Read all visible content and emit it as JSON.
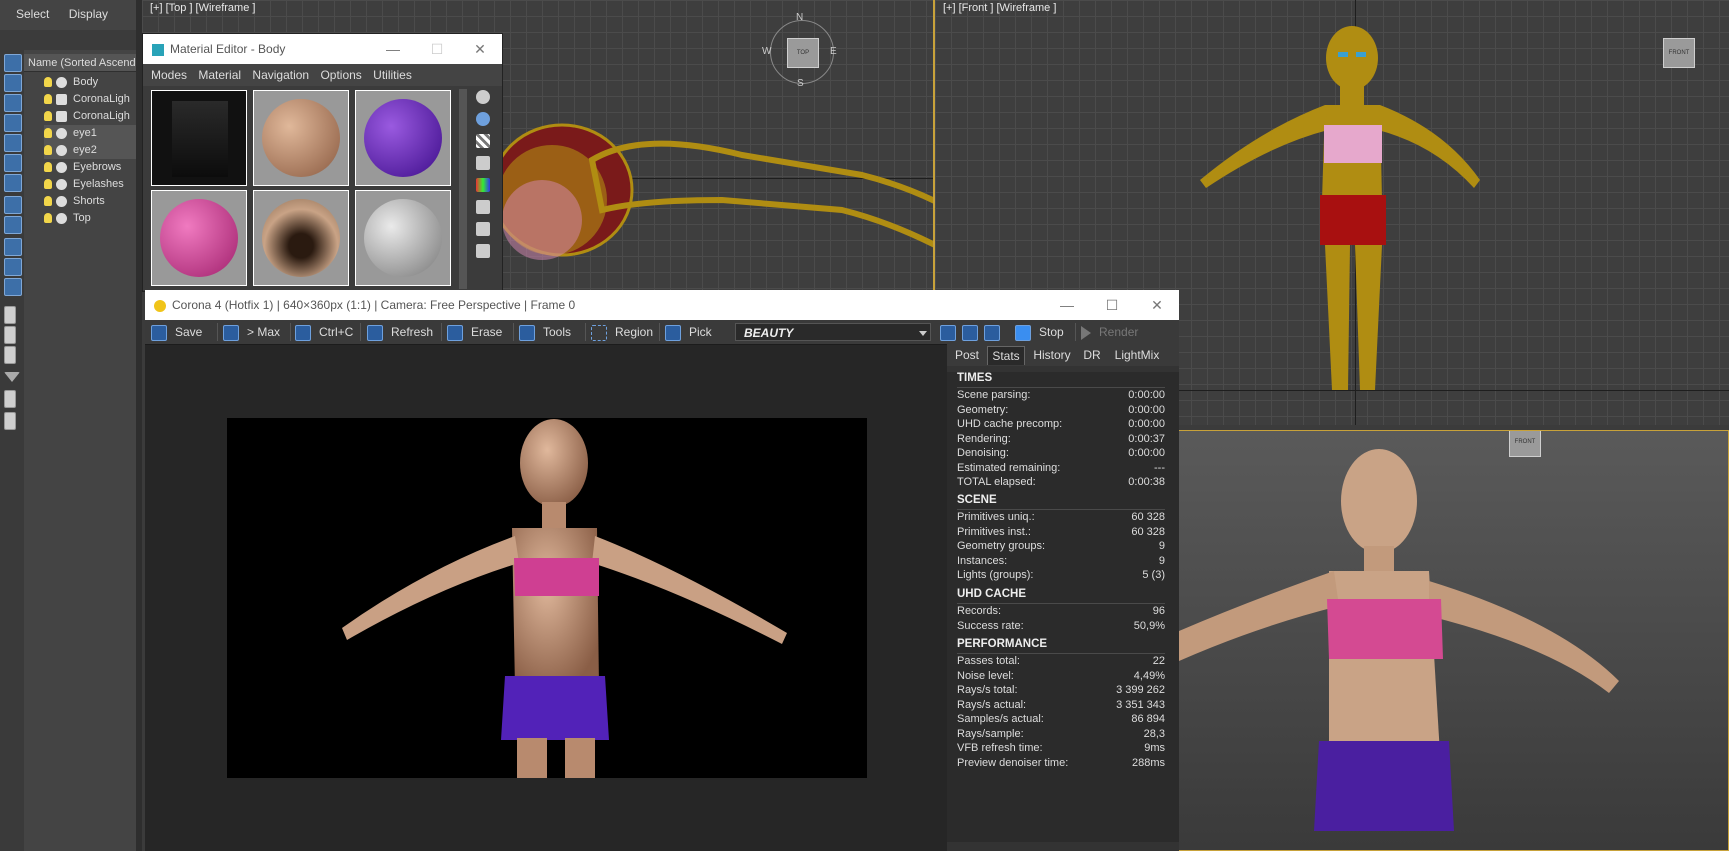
{
  "top_menu": {
    "select": "Select",
    "display": "Display"
  },
  "scene_explorer": {
    "header": "Name (Sorted Ascendi",
    "items": [
      {
        "label": "Body",
        "type": "object"
      },
      {
        "label": "CoronaLigh",
        "type": "light"
      },
      {
        "label": "CoronaLigh",
        "type": "light"
      },
      {
        "label": "eye1",
        "type": "object"
      },
      {
        "label": "eye2",
        "type": "object"
      },
      {
        "label": "Eyebrows",
        "type": "object"
      },
      {
        "label": "Eyelashes",
        "type": "object"
      },
      {
        "label": "Shorts",
        "type": "object"
      },
      {
        "label": "Top",
        "type": "object"
      }
    ]
  },
  "viewports": {
    "top": {
      "label": "[+] [Top ] [Wireframe ]",
      "compass": {
        "n": "N",
        "s": "S",
        "e": "E",
        "w": "W",
        "center": "TOP"
      }
    },
    "front": {
      "label": "[+] [Front ] [Wireframe ]",
      "cube": "FRONT"
    },
    "perspective": {
      "cube": "FRONT"
    }
  },
  "material_editor": {
    "title": "Material Editor - Body",
    "menu": [
      "Modes",
      "Material",
      "Navigation",
      "Options",
      "Utilities"
    ],
    "controls": {
      "minimize": "—",
      "maximize": "☐",
      "close": "✕"
    }
  },
  "vfb": {
    "title": "Corona 4 (Hotfix 1) | 640×360px (1:1) | Camera: Free Perspective | Frame 0",
    "controls": {
      "minimize": "—",
      "maximize": "☐",
      "close": "✕"
    },
    "toolbar": {
      "save": "Save",
      "max": "> Max",
      "copy": "Ctrl+C",
      "refresh": "Refresh",
      "erase": "Erase",
      "tools": "Tools",
      "region": "Region",
      "pick": "Pick",
      "channel": "BEAUTY",
      "stop": "Stop",
      "render": "Render"
    },
    "tabs": [
      "Post",
      "Stats",
      "History",
      "DR",
      "LightMix"
    ],
    "active_tab": "Stats",
    "stats": {
      "times_title": "TIMES",
      "times": [
        {
          "k": "Scene parsing:",
          "v": "0:00:00"
        },
        {
          "k": "Geometry:",
          "v": "0:00:00"
        },
        {
          "k": "UHD cache precomp:",
          "v": "0:00:00"
        },
        {
          "k": "Rendering:",
          "v": "0:00:37"
        },
        {
          "k": "Denoising:",
          "v": "0:00:00"
        },
        {
          "k": "Estimated remaining:",
          "v": "---"
        },
        {
          "k": "TOTAL elapsed:",
          "v": "0:00:38"
        }
      ],
      "scene_title": "SCENE",
      "scene": [
        {
          "k": "Primitives uniq.:",
          "v": "60 328"
        },
        {
          "k": "Primitives inst.:",
          "v": "60 328"
        },
        {
          "k": "Geometry groups:",
          "v": "9"
        },
        {
          "k": "Instances:",
          "v": "9"
        },
        {
          "k": "Lights (groups):",
          "v": "5 (3)"
        }
      ],
      "uhd_title": "UHD CACHE",
      "uhd": [
        {
          "k": "Records:",
          "v": "96"
        },
        {
          "k": "Success rate:",
          "v": "50,9%"
        }
      ],
      "perf_title": "PERFORMANCE",
      "perf": [
        {
          "k": "Passes total:",
          "v": "22"
        },
        {
          "k": "Noise level:",
          "v": "4,49%"
        },
        {
          "k": "Rays/s total:",
          "v": "3 399 262"
        },
        {
          "k": "Rays/s actual:",
          "v": "3 351 343"
        },
        {
          "k": "Samples/s actual:",
          "v": "86 894"
        },
        {
          "k": "Rays/sample:",
          "v": "28,3"
        },
        {
          "k": "VFB refresh time:",
          "v": "9ms"
        },
        {
          "k": "Preview denoiser time:",
          "v": "288ms"
        }
      ]
    }
  },
  "colors": {
    "accent": "#3d6fa8",
    "viewport_active": "#c8a23a",
    "wire_body": "#b08d12",
    "top_pink": "#d4478f",
    "shorts_purple": "#4a1fa0"
  }
}
